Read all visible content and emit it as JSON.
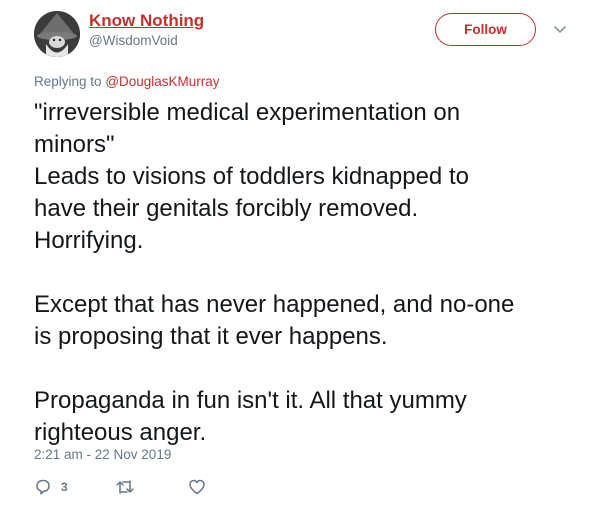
{
  "user": {
    "display_name": "Know Nothing",
    "handle": "@WisdomVoid"
  },
  "follow_button": {
    "label": "Follow"
  },
  "reply_context": {
    "prefix": "Replying to",
    "mention": "@DouglasKMurray"
  },
  "tweet": {
    "paragraphs": [
      [
        "\"irreversible medical experimentation on",
        "minors\"",
        "Leads to visions of toddlers kidnapped to",
        "have their genitals forcibly removed.",
        "Horrifying."
      ],
      [
        "Except that has never happened, and no-one",
        "is proposing that it ever happens."
      ],
      [
        "Propaganda in fun isn't it. All that yummy",
        "righteous anger."
      ]
    ],
    "timestamp": "2:21 am - 22 Nov 2019"
  },
  "actions": {
    "reply_count": "3",
    "reply_icon": "speech-bubble-icon",
    "retweet_icon": "retweet-icon",
    "like_icon": "heart-icon"
  },
  "colors": {
    "accent": "#c4302b",
    "muted": "#657786",
    "text": "#14171a"
  }
}
